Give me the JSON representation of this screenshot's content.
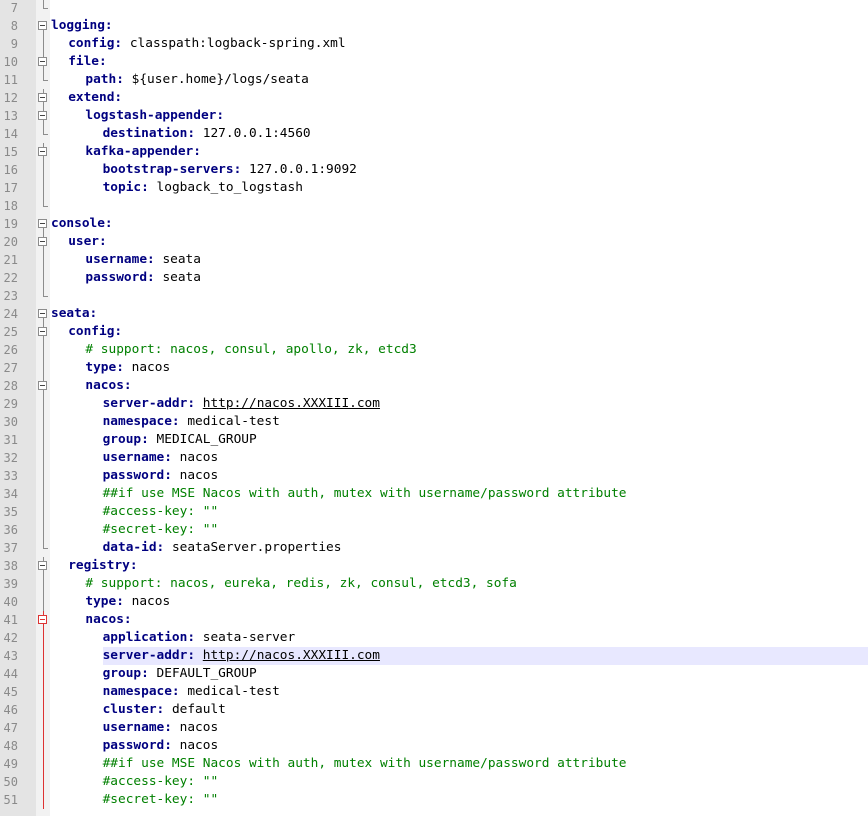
{
  "editor": {
    "current_line": 43,
    "colors": {
      "key": "#000080",
      "comment": "#008000",
      "value": "#000000",
      "gutter": "#e4e4e4",
      "fold_margin": "#f2f2f2",
      "current_line_highlight": "#e8e8ff",
      "change_bar": "#dd3333"
    },
    "lines": [
      {
        "n": "7",
        "indent": 0,
        "key": "",
        "value": "",
        "comment": "",
        "fold": "end"
      },
      {
        "n": "8",
        "indent": 0,
        "key": "logging:",
        "value": "",
        "comment": "",
        "fold": "open-top"
      },
      {
        "n": "9",
        "indent": 2,
        "key": "config:",
        "value": " classpath:logback-spring.xml",
        "comment": "",
        "fold": "line"
      },
      {
        "n": "10",
        "indent": 2,
        "key": "file:",
        "value": "",
        "comment": "",
        "fold": "open"
      },
      {
        "n": "11",
        "indent": 4,
        "key": "path:",
        "value": " ${user.home}/logs/seata",
        "comment": "",
        "fold": "end"
      },
      {
        "n": "12",
        "indent": 2,
        "key": "extend:",
        "value": "",
        "comment": "",
        "fold": "open"
      },
      {
        "n": "13",
        "indent": 4,
        "key": "logstash-appender:",
        "value": "",
        "comment": "",
        "fold": "open"
      },
      {
        "n": "14",
        "indent": 6,
        "key": "destination:",
        "value": " 127.0.0.1:4560",
        "comment": "",
        "fold": "end"
      },
      {
        "n": "15",
        "indent": 4,
        "key": "kafka-appender:",
        "value": "",
        "comment": "",
        "fold": "open"
      },
      {
        "n": "16",
        "indent": 6,
        "key": "bootstrap-servers:",
        "value": " 127.0.0.1:9092",
        "comment": "",
        "fold": "line"
      },
      {
        "n": "17",
        "indent": 6,
        "key": "topic:",
        "value": " logback_to_logstash",
        "comment": "",
        "fold": "line"
      },
      {
        "n": "18",
        "indent": 0,
        "key": "",
        "value": "",
        "comment": "",
        "fold": "end"
      },
      {
        "n": "19",
        "indent": 0,
        "key": "console:",
        "value": "",
        "comment": "",
        "fold": "open-top"
      },
      {
        "n": "20",
        "indent": 2,
        "key": "user:",
        "value": "",
        "comment": "",
        "fold": "open"
      },
      {
        "n": "21",
        "indent": 4,
        "key": "username:",
        "value": " seata",
        "comment": "",
        "fold": "line"
      },
      {
        "n": "22",
        "indent": 4,
        "key": "password:",
        "value": " seata",
        "comment": "",
        "fold": "line"
      },
      {
        "n": "23",
        "indent": 0,
        "key": "",
        "value": "",
        "comment": "",
        "fold": "end"
      },
      {
        "n": "24",
        "indent": 0,
        "key": "seata:",
        "value": "",
        "comment": "",
        "fold": "open-top"
      },
      {
        "n": "25",
        "indent": 2,
        "key": "config:",
        "value": "",
        "comment": "",
        "fold": "open"
      },
      {
        "n": "26",
        "indent": 4,
        "key": "",
        "value": "",
        "comment": "# support: nacos, consul, apollo, zk, etcd3",
        "fold": "line"
      },
      {
        "n": "27",
        "indent": 4,
        "key": "type:",
        "value": " nacos",
        "comment": "",
        "fold": "line"
      },
      {
        "n": "28",
        "indent": 4,
        "key": "nacos:",
        "value": "",
        "comment": "",
        "fold": "open"
      },
      {
        "n": "29",
        "indent": 6,
        "key": "server-addr:",
        "value": " ",
        "link": "http://nacos.XXXIII.com",
        "comment": "",
        "fold": "line"
      },
      {
        "n": "30",
        "indent": 6,
        "key": "namespace:",
        "value": " medical-test",
        "comment": "",
        "fold": "line"
      },
      {
        "n": "31",
        "indent": 6,
        "key": "group:",
        "value": " MEDICAL_GROUP",
        "comment": "",
        "fold": "line"
      },
      {
        "n": "32",
        "indent": 6,
        "key": "username:",
        "value": " nacos",
        "comment": "",
        "fold": "line"
      },
      {
        "n": "33",
        "indent": 6,
        "key": "password:",
        "value": " nacos",
        "comment": "",
        "fold": "line"
      },
      {
        "n": "34",
        "indent": 6,
        "key": "",
        "value": "",
        "comment": "##if use MSE Nacos with auth, mutex with username/password attribute",
        "fold": "line"
      },
      {
        "n": "35",
        "indent": 6,
        "key": "",
        "value": "",
        "comment": "#access-key: \"\"",
        "fold": "line"
      },
      {
        "n": "36",
        "indent": 6,
        "key": "",
        "value": "",
        "comment": "#secret-key: \"\"",
        "fold": "line"
      },
      {
        "n": "37",
        "indent": 6,
        "key": "data-id:",
        "value": " seataServer.properties",
        "comment": "",
        "fold": "end"
      },
      {
        "n": "38",
        "indent": 2,
        "key": "registry:",
        "value": "",
        "comment": "",
        "fold": "open"
      },
      {
        "n": "39",
        "indent": 4,
        "key": "",
        "value": "",
        "comment": "# support: nacos, eureka, redis, zk, consul, etcd3, sofa",
        "fold": "line"
      },
      {
        "n": "40",
        "indent": 4,
        "key": "type:",
        "value": " nacos",
        "comment": "",
        "fold": "line"
      },
      {
        "n": "41",
        "indent": 4,
        "key": "nacos:",
        "value": "",
        "comment": "",
        "fold": "open-red"
      },
      {
        "n": "42",
        "indent": 6,
        "key": "application:",
        "value": " seata-server",
        "comment": "",
        "fold": "red"
      },
      {
        "n": "43",
        "indent": 6,
        "key": "server-addr:",
        "value": " ",
        "link": "http://nacos.XXXIII.com",
        "comment": "",
        "fold": "red"
      },
      {
        "n": "44",
        "indent": 6,
        "key": "group:",
        "value": " DEFAULT_GROUP",
        "comment": "",
        "fold": "red"
      },
      {
        "n": "45",
        "indent": 6,
        "key": "namespace:",
        "value": " medical-test",
        "comment": "",
        "fold": "red"
      },
      {
        "n": "46",
        "indent": 6,
        "key": "cluster:",
        "value": " default",
        "comment": "",
        "fold": "red"
      },
      {
        "n": "47",
        "indent": 6,
        "key": "username:",
        "value": " nacos",
        "comment": "",
        "fold": "red"
      },
      {
        "n": "48",
        "indent": 6,
        "key": "password:",
        "value": " nacos",
        "comment": "",
        "fold": "red"
      },
      {
        "n": "49",
        "indent": 6,
        "key": "",
        "value": "",
        "comment": "##if use MSE Nacos with auth, mutex with username/password attribute",
        "fold": "red"
      },
      {
        "n": "50",
        "indent": 6,
        "key": "",
        "value": "",
        "comment": "#access-key: \"\"",
        "fold": "red"
      },
      {
        "n": "51",
        "indent": 6,
        "key": "",
        "value": "",
        "comment": "#secret-key: \"\"",
        "fold": "red"
      }
    ]
  }
}
